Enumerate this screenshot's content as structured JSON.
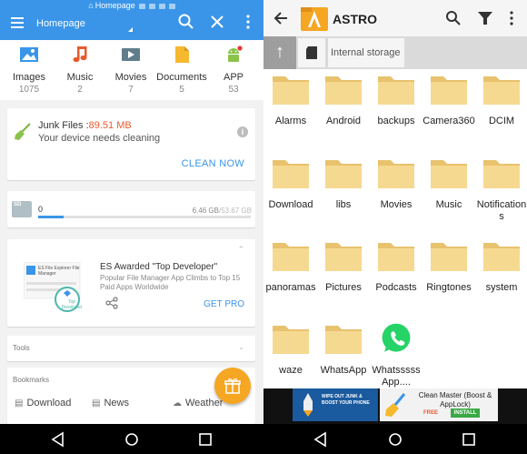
{
  "left": {
    "status_title": "Homepage",
    "header_title": "Homepage",
    "categories": [
      {
        "label": "Images",
        "count": "1075",
        "icon": "image-icon",
        "color": "#3a95e8"
      },
      {
        "label": "Music",
        "count": "2",
        "icon": "music-note-icon",
        "color": "#e85a2b"
      },
      {
        "label": "Movies",
        "count": "7",
        "icon": "movie-icon",
        "color": "#607d8b"
      },
      {
        "label": "Documents",
        "count": "5",
        "icon": "document-icon",
        "color": "#f5b82e"
      },
      {
        "label": "APP",
        "count": "53",
        "icon": "android-icon",
        "color": "#8bc34a"
      }
    ],
    "junk": {
      "title_prefix": "Junk Files :",
      "size": "89.51 MB",
      "subtitle": "Your device needs cleaning",
      "info": "i",
      "action": "CLEAN NOW"
    },
    "storage": {
      "badge": "SD",
      "used_label": "0",
      "used": "6.46 GB",
      "total": "/53.67 GB",
      "fill_fraction": 0.12
    },
    "promo": {
      "title": "ES Awarded \"Top Developer\"",
      "description": "Popular File Manager App Climbs to Top 15 Paid Apps Worldwide",
      "action": "GET PRO",
      "thumb_title": "ES File Explorer File Manager",
      "thumb_badge": "Top Developer"
    },
    "tools_label": "Tools",
    "bookmarks": {
      "label": "Bookmarks",
      "items": [
        {
          "label": "Download",
          "icon": "download-icon"
        },
        {
          "label": "News",
          "icon": "news-icon"
        },
        {
          "label": "Weather",
          "icon": "weather-icon"
        }
      ]
    }
  },
  "right": {
    "title": "ASTRO",
    "path": "Internal storage",
    "folders": [
      "Alarms",
      "Android",
      "backups",
      "Camera360",
      "DCIM",
      "Download",
      "libs",
      "Movies",
      "Music",
      "Notifications",
      "panoramas",
      "Pictures",
      "Podcasts",
      "Ringtones",
      "system",
      "waze",
      "WhatsApp",
      "WhatsssssApp...."
    ],
    "ad": {
      "left_text": "WIPE OUT JUNK & BOOST YOUR PHONE",
      "title": "Clean Master (Boost & AppLock)",
      "free": "FREE",
      "install": "INSTALL"
    }
  },
  "colors": {
    "es_blue": "#3a95e8",
    "folder": "#f6d991",
    "folder_dark": "#e8c26d",
    "whatsapp": "#25d366"
  }
}
